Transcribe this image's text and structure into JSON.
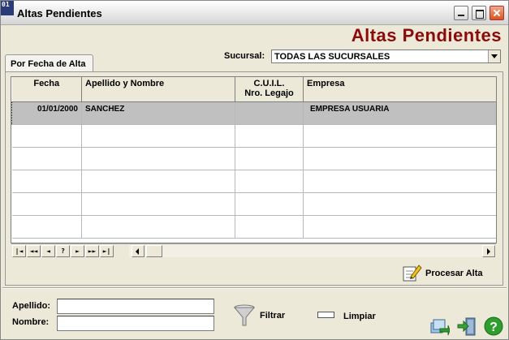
{
  "window": {
    "title": "Altas Pendientes",
    "icon_text": "01"
  },
  "header": {
    "big_title": "Altas Pendientes"
  },
  "filter": {
    "sucursal_label": "Sucursal:",
    "sucursal_value": "TODAS LAS SUCURSALES"
  },
  "tab": {
    "label": "Por Fecha de Alta"
  },
  "grid": {
    "columns": [
      "Fecha",
      "Apellido y Nombre",
      "C.U.I.L.",
      "Nro. Legajo",
      "Empresa"
    ],
    "rows": [
      {
        "fecha": "01/01/2000",
        "nombre": "SANCHEZ",
        "cuil": "",
        "empresa": "EMPRESA USUARIA"
      }
    ]
  },
  "navigator": {
    "buttons": [
      "|◄",
      "◄◄",
      "◄",
      "?",
      "►",
      "►►",
      "►|"
    ]
  },
  "actions": {
    "procesar": "Procesar Alta",
    "filtrar": "Filtrar",
    "limpiar": "Limpiar"
  },
  "search": {
    "apellido_label": "Apellido:",
    "nombre_label": "Nombre:",
    "apellido_value": "",
    "nombre_value": ""
  },
  "icons": {
    "filtrar": "funnel-icon",
    "procesar": "edit-document-icon",
    "export": "export-icon",
    "exit": "exit-door-icon",
    "help": "help-icon"
  },
  "colors": {
    "title_accent": "#8b0a0a",
    "selected_row": "#c0c0c0"
  }
}
